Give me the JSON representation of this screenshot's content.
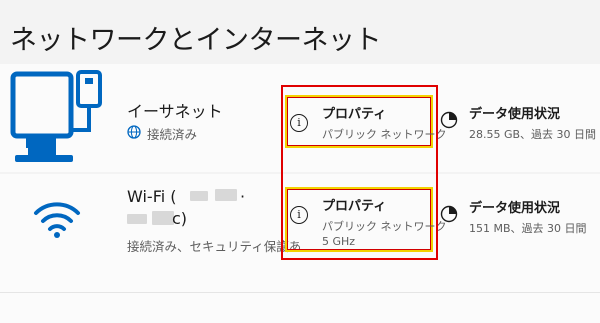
{
  "page": {
    "title": "ネットワークとインターネット"
  },
  "ethernet": {
    "name": "イーサネット",
    "status": "接続済み",
    "properties": {
      "title": "プロパティ",
      "detail": "パブリック ネットワーク"
    },
    "usage": {
      "title": "データ使用状況",
      "detail": "28.55 GB、過去 30 日間"
    }
  },
  "wifi": {
    "name_line1": "Wi-Fi (",
    "name_dot": "·",
    "name_line2_end": "c)",
    "status": "接続済み、セキュリティ保護あ",
    "properties": {
      "title": "プロパティ",
      "detail": "パブリック ネットワーク",
      "band": "5 GHz"
    },
    "usage": {
      "title": "データ使用状況",
      "detail": "151 MB、過去 30 日間"
    }
  },
  "colors": {
    "accent": "#0067c0",
    "highlight_red": "#e00000",
    "highlight_yellow": "#f4d200"
  },
  "icons": {
    "ethernet": "monitor-ethernet-icon",
    "wifi": "wifi-icon",
    "globe": "globe-icon",
    "info": "info-icon",
    "usage": "pie-chart-icon"
  }
}
